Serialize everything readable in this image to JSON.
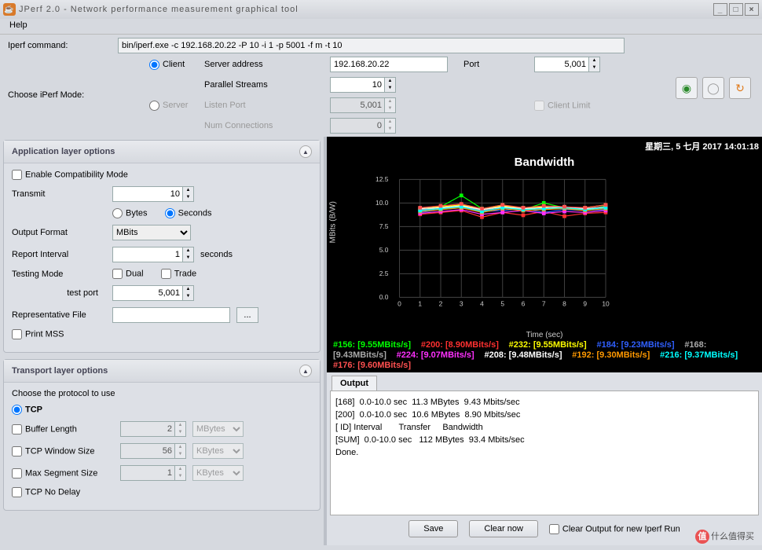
{
  "window": {
    "title": "JPerf 2.0 - Network performance measurement graphical tool",
    "help_menu": "Help"
  },
  "cmdrow": {
    "label": "Iperf command:",
    "value": "bin/iperf.exe -c 192.168.20.22 -P 10 -i 1 -p 5001 -f m -t 10"
  },
  "mode": {
    "label": "Choose iPerf Mode:",
    "client": "Client",
    "server": "Server",
    "server_addr_label": "Server address",
    "server_addr": "192.168.20.22",
    "port_label": "Port",
    "port": "5,001",
    "parallel_label": "Parallel Streams",
    "parallel": "10",
    "listen_port_label": "Listen Port",
    "listen_port": "5,001",
    "client_limit_label": "Client Limit",
    "numconn_label": "Num Connections",
    "numconn": "0"
  },
  "app_opts": {
    "title": "Application layer options",
    "compat": "Enable Compatibility Mode",
    "transmit_label": "Transmit",
    "transmit": "10",
    "bytes": "Bytes",
    "seconds": "Seconds",
    "outfmt_label": "Output Format",
    "outfmt": "MBits",
    "rint_label": "Report Interval",
    "rint": "1",
    "rint_unit": "seconds",
    "testmode_label": "Testing Mode",
    "dual": "Dual",
    "trade": "Trade",
    "testport_label": "test port",
    "testport": "5,001",
    "repfile_label": "Representative File",
    "printmss": "Print MSS"
  },
  "trans_opts": {
    "title": "Transport layer options",
    "choose": "Choose the protocol to use",
    "tcp": "TCP",
    "buflen": "Buffer Length",
    "buflen_v": "2",
    "buflen_u": "MBytes",
    "winsize": "TCP Window Size",
    "winsize_v": "56",
    "winsize_u": "KBytes",
    "maxseg": "Max Segment Size",
    "maxseg_v": "1",
    "maxseg_u": "KBytes",
    "nodelay": "TCP No Delay"
  },
  "chart_data": {
    "type": "line",
    "title": "Bandwidth",
    "timestamp": "星期三, 5 七月 2017 14:01:18",
    "xlabel": "Time (sec)",
    "ylabel": "MBits (B/W)",
    "x": [
      1,
      2,
      3,
      4,
      5,
      6,
      7,
      8,
      9,
      10
    ],
    "xlim": [
      0,
      10
    ],
    "ylim": [
      0,
      12.5
    ],
    "yticks": [
      0,
      2.5,
      5.0,
      7.5,
      10.0,
      12.5
    ],
    "series": [
      {
        "name": "#156",
        "rate": "9.55MBits/s",
        "color": "#00ff00",
        "values": [
          9.2,
          9.6,
          10.8,
          9.4,
          9.8,
          9.3,
          10.0,
          9.5,
          9.2,
          9.7
        ]
      },
      {
        "name": "#200",
        "rate": "8.90MBits/s",
        "color": "#ff3030",
        "values": [
          8.8,
          9.0,
          9.2,
          8.5,
          9.0,
          8.7,
          9.1,
          8.6,
          8.9,
          9.0
        ]
      },
      {
        "name": "#232",
        "rate": "9.55MBits/s",
        "color": "#ffff00",
        "values": [
          9.4,
          9.6,
          9.8,
          9.3,
          9.7,
          9.5,
          9.6,
          9.4,
          9.5,
          9.8
        ]
      },
      {
        "name": "#184",
        "rate": "9.23MBits/s",
        "color": "#3060ff",
        "values": [
          9.0,
          9.3,
          9.5,
          9.1,
          9.2,
          9.4,
          9.0,
          9.3,
          9.2,
          9.3
        ]
      },
      {
        "name": "#168",
        "rate": "9.43MBits/s",
        "color": "#aaaaaa",
        "values": [
          9.3,
          9.4,
          9.6,
          9.2,
          9.5,
          9.4,
          9.3,
          9.5,
          9.4,
          9.6
        ]
      },
      {
        "name": "#224",
        "rate": "9.07MBits/s",
        "color": "#ff30ff",
        "values": [
          8.9,
          9.1,
          9.3,
          8.8,
          9.0,
          9.2,
          8.9,
          9.1,
          9.0,
          9.2
        ]
      },
      {
        "name": "#208",
        "rate": "9.48MBits/s",
        "color": "#ffffff",
        "values": [
          9.4,
          9.5,
          9.7,
          9.3,
          9.6,
          9.4,
          9.5,
          9.6,
          9.4,
          9.5
        ]
      },
      {
        "name": "#192",
        "rate": "9.30MBits/s",
        "color": "#ff9900",
        "values": [
          9.1,
          9.3,
          9.5,
          9.0,
          9.4,
          9.2,
          9.3,
          9.4,
          9.2,
          9.4
        ]
      },
      {
        "name": "#216",
        "rate": "9.37MBits/s",
        "color": "#00ffff",
        "values": [
          9.2,
          9.4,
          9.6,
          9.1,
          9.5,
          9.3,
          9.4,
          9.5,
          9.3,
          9.5
        ]
      },
      {
        "name": "#176",
        "rate": "9.60MBits/s",
        "color": "#ff5050",
        "values": [
          9.5,
          9.7,
          9.9,
          9.4,
          9.8,
          9.5,
          9.7,
          9.6,
          9.5,
          9.8
        ]
      }
    ]
  },
  "output": {
    "tab": "Output",
    "lines": "[168]  0.0-10.0 sec  11.3 MBytes  9.43 Mbits/sec\n[200]  0.0-10.0 sec  10.6 MBytes  8.90 Mbits/sec\n[ ID] Interval       Transfer     Bandwidth\n[SUM]  0.0-10.0 sec   112 MBytes  93.4 Mbits/sec\nDone.",
    "save": "Save",
    "clearnow": "Clear now",
    "clearcb": "Clear Output for new Iperf Run"
  },
  "watermark": "什么值得买"
}
